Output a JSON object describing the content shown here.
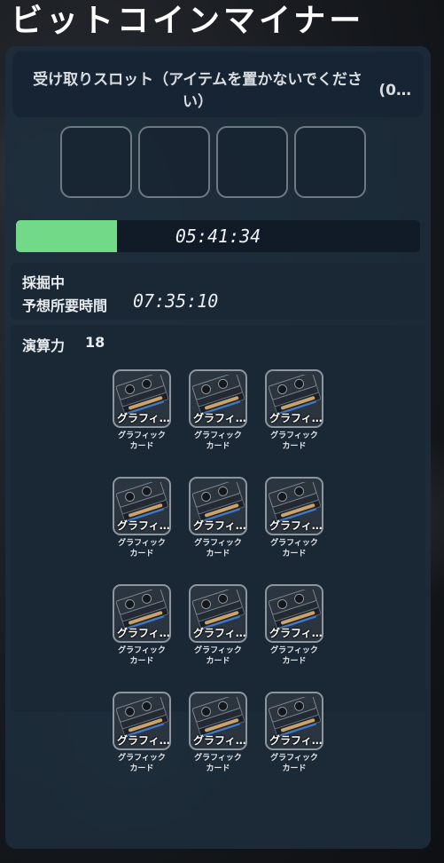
{
  "title": "ビットコインマイナー",
  "slot_header": {
    "label": "受け取りスロット（アイテムを置かないでください）",
    "count": "(0…"
  },
  "slots": [
    {},
    {},
    {},
    {}
  ],
  "progress": {
    "fraction": 0.25,
    "time": "05:41:34",
    "color": "#71d987"
  },
  "status": {
    "text": "採掘中",
    "eta_label": "予想所要時間",
    "eta_time": "07:35:10"
  },
  "power": {
    "label": "演算力",
    "value": "18"
  },
  "items": [
    {
      "short": "グラフィ…",
      "name": "グラフィック\nカード",
      "icon": "graphics-card-icon"
    },
    {
      "short": "グラフィ…",
      "name": "グラフィック\nカード",
      "icon": "graphics-card-icon"
    },
    {
      "short": "グラフィ…",
      "name": "グラフィック\nカード",
      "icon": "graphics-card-icon"
    },
    {
      "short": "グラフィ…",
      "name": "グラフィック\nカード",
      "icon": "graphics-card-icon"
    },
    {
      "short": "グラフィ…",
      "name": "グラフィック\nカード",
      "icon": "graphics-card-icon"
    },
    {
      "short": "グラフィ…",
      "name": "グラフィック\nカード",
      "icon": "graphics-card-icon"
    },
    {
      "short": "グラフィ…",
      "name": "グラフィック\nカード",
      "icon": "graphics-card-icon"
    },
    {
      "short": "グラフィ…",
      "name": "グラフィック\nカード",
      "icon": "graphics-card-icon"
    },
    {
      "short": "グラフィ…",
      "name": "グラフィック\nカード",
      "icon": "graphics-card-icon"
    },
    {
      "short": "グラフィ…",
      "name": "グラフィック\nカード",
      "icon": "graphics-card-icon"
    },
    {
      "short": "グラフィ…",
      "name": "グラフィック\nカード",
      "icon": "graphics-card-icon"
    },
    {
      "short": "グラフィ…",
      "name": "グラフィック\nカード",
      "icon": "graphics-card-icon"
    }
  ]
}
